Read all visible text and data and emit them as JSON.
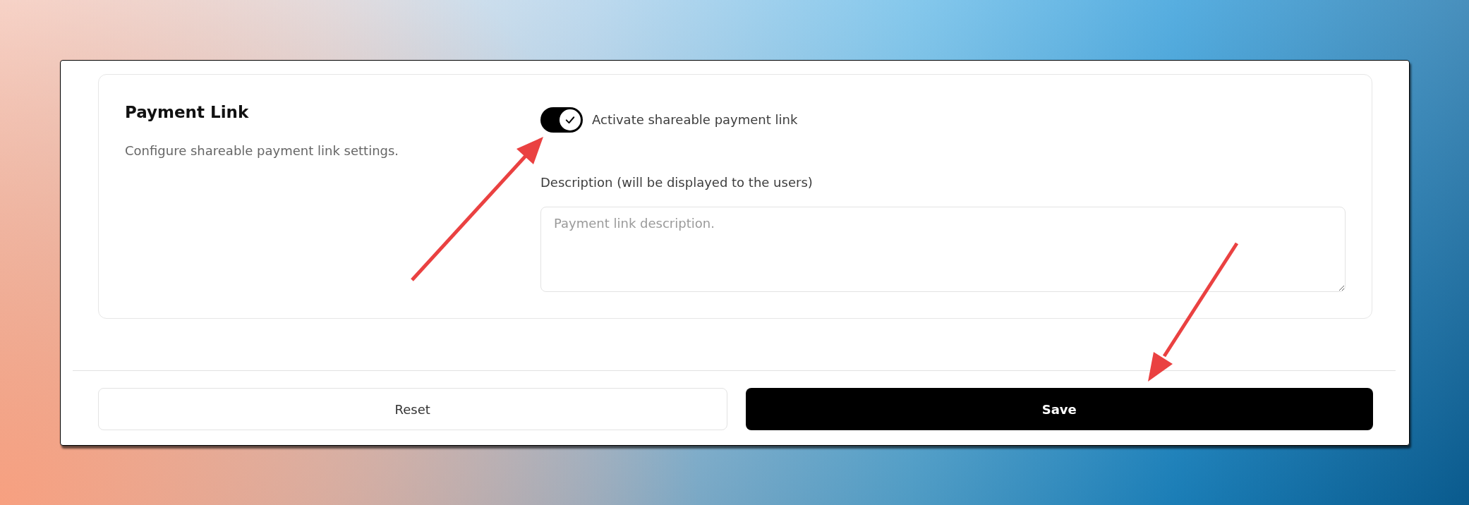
{
  "section": {
    "title": "Payment Link",
    "description": "Configure shareable payment link settings."
  },
  "toggle": {
    "label": "Activate shareable payment link",
    "on": true
  },
  "description_field": {
    "label": "Description (will be displayed to the users)",
    "placeholder": "Payment link description."
  },
  "buttons": [
    {
      "label": "Reset",
      "kind": "secondary"
    },
    {
      "label": "Save",
      "kind": "primary"
    }
  ]
}
